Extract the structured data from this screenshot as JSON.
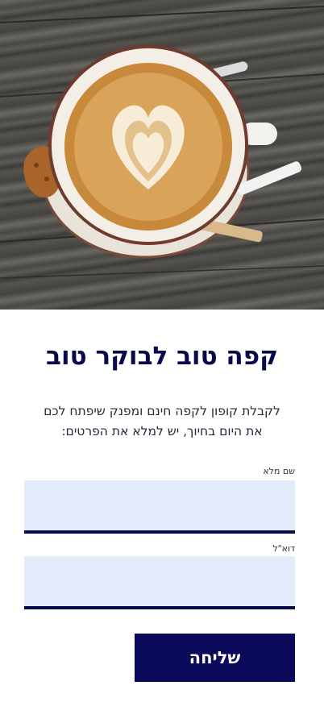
{
  "hero": {
    "image_description_icon": "coffee-latte-image"
  },
  "form": {
    "title": "קפה טוב לבוקר טוב",
    "subtitle_line1": "לקבלת קופון לקפה חינם ומפנק שיפתח לכם",
    "subtitle_line2": "את היום בחיוך, יש למלא את הפרטים:",
    "full_name_label": "שם מלא",
    "full_name_value": "",
    "email_label": "דוא\"ל",
    "email_value": "",
    "submit_label": "שליחה"
  },
  "colors": {
    "brand_navy": "#0a0a4a",
    "input_bg": "#e3ecfa"
  }
}
